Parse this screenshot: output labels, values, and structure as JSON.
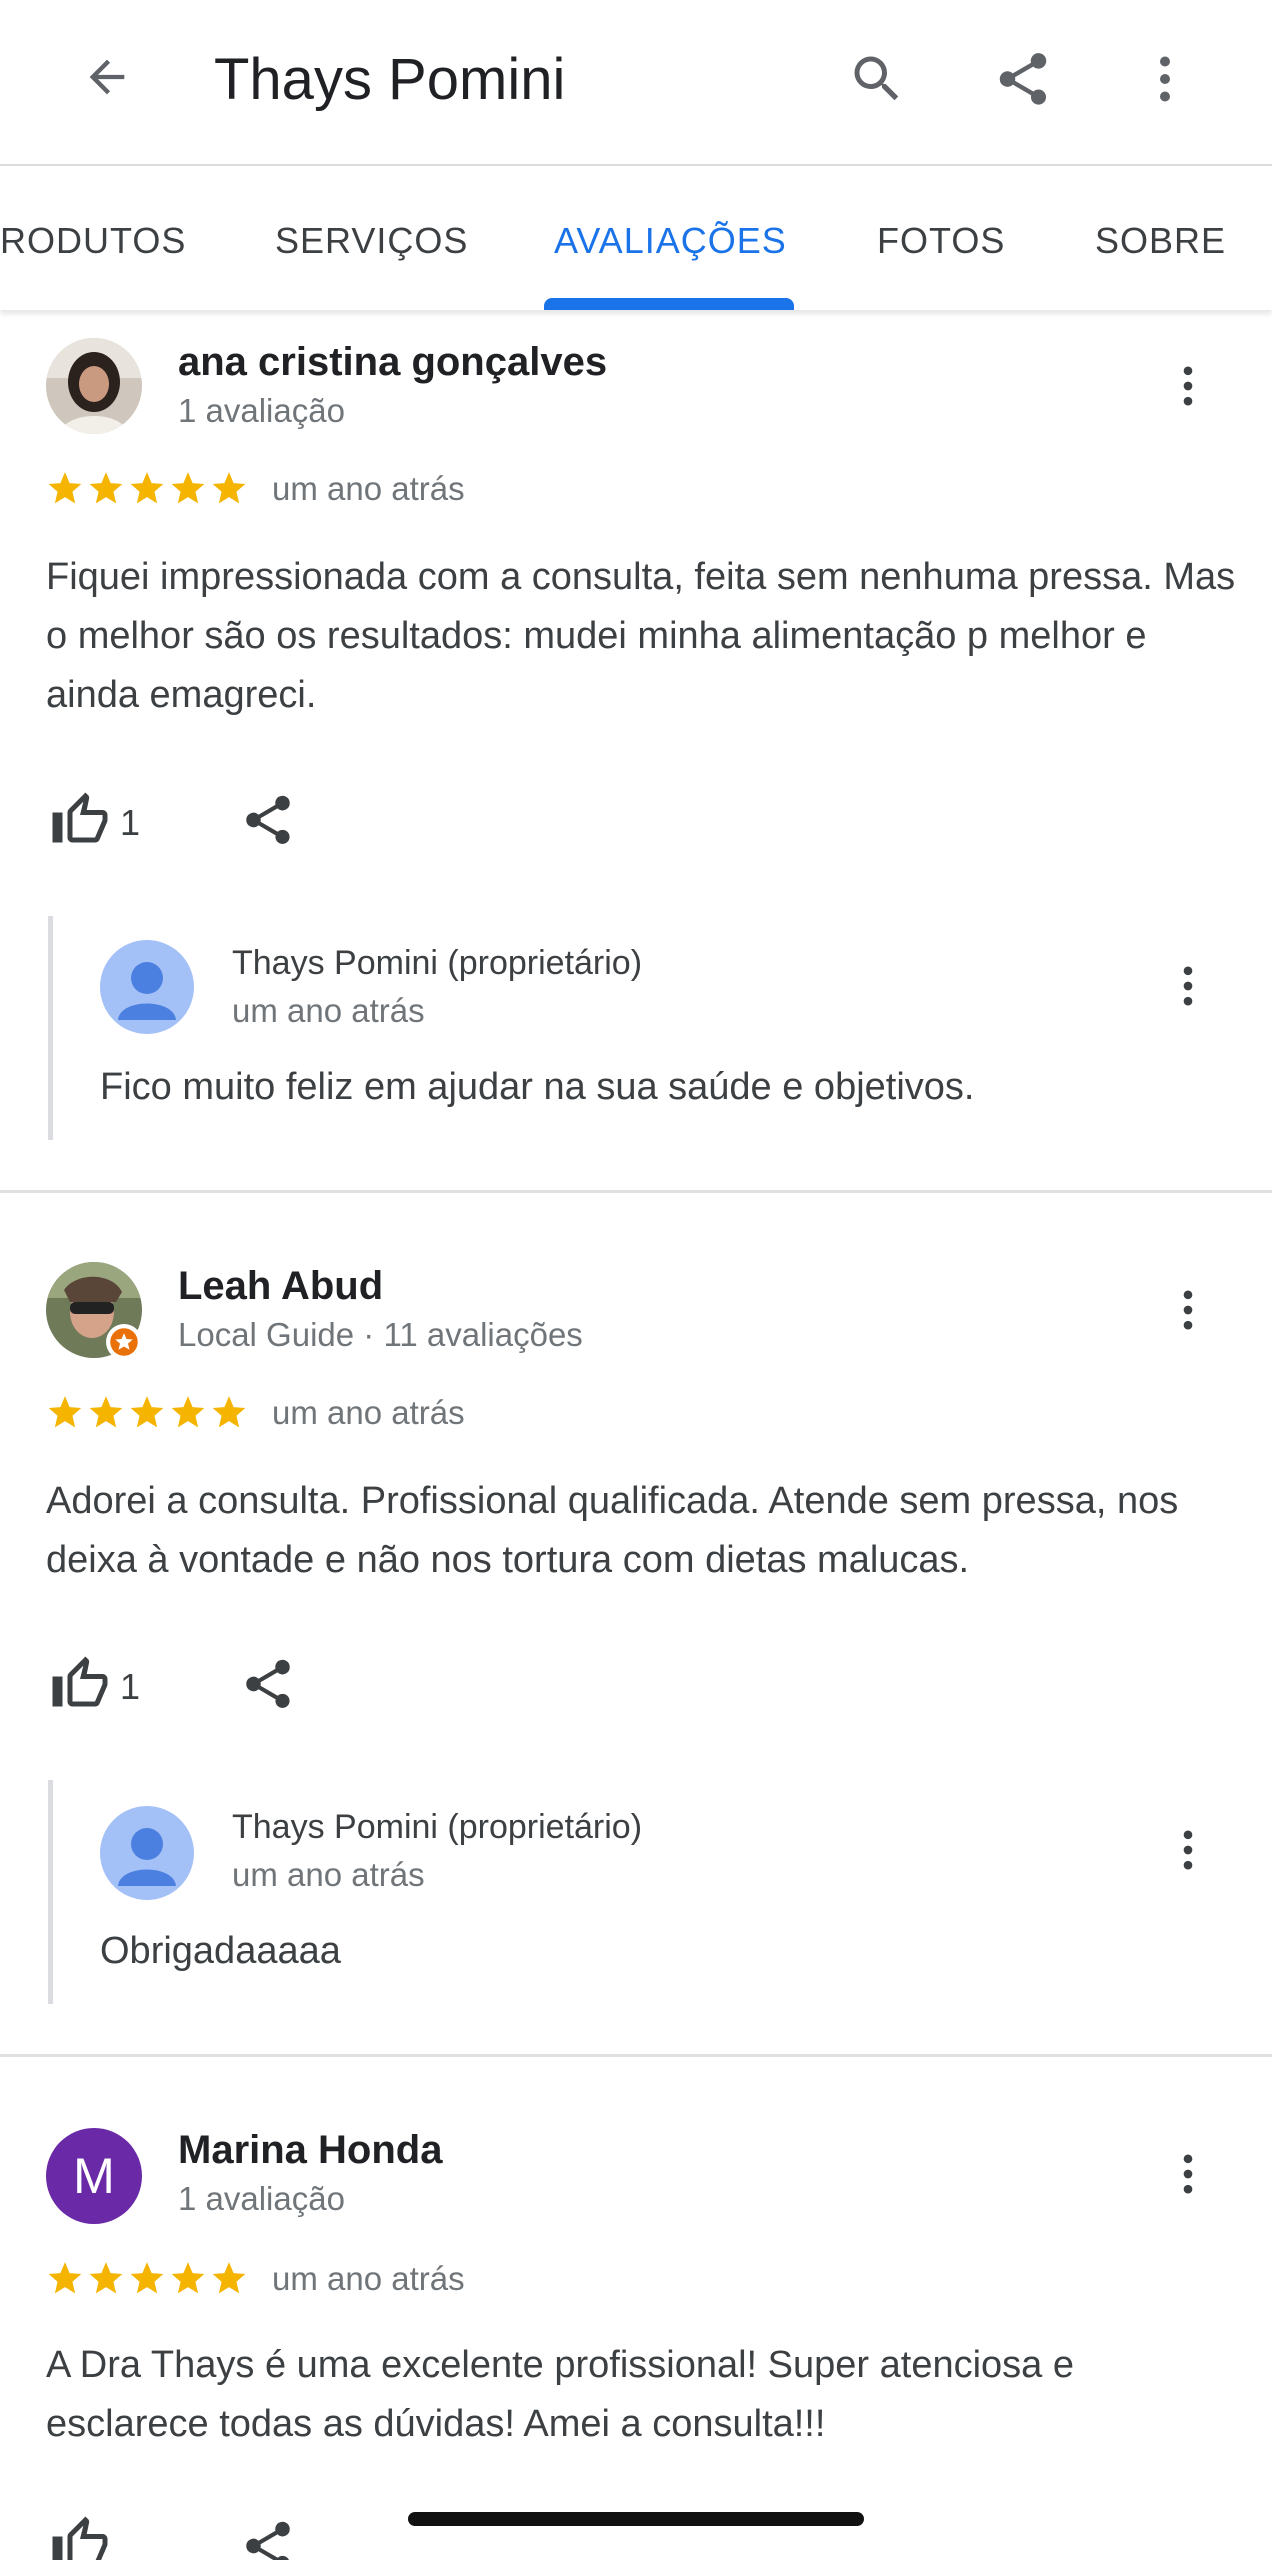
{
  "header": {
    "title": "Thays Pomini",
    "back_icon": "arrow-left-icon",
    "actions": [
      "search-icon",
      "share-icon",
      "more-vert-icon"
    ]
  },
  "tabs": [
    {
      "label": "RODUTOS",
      "active": false
    },
    {
      "label": "SERVIÇOS",
      "active": false
    },
    {
      "label": "AVALIAÇÕES",
      "active": true
    },
    {
      "label": "FOTOS",
      "active": false
    },
    {
      "label": "SOBRE",
      "active": false
    }
  ],
  "colors": {
    "accent": "#1a73e8",
    "star": "#f4b400",
    "reply_avatar_bg": "#a3c0f7",
    "marina_avatar": "#6a2aa8"
  },
  "reviews": [
    {
      "name": "ana cristina gonçalves",
      "meta": "1 avaliação",
      "rating": 5,
      "date": "um ano atrás",
      "text": "Fiquei impressionada com a consulta, feita sem nenhuma pressa. Mas o melhor são os resultados: mudei minha alimentação p melhor e ainda emagreci.",
      "likes": "1",
      "reply": {
        "name": "Thays Pomini (proprietário)",
        "date": "um ano atrás",
        "text": "Fico muito feliz em ajudar na sua saúde e objetivos."
      }
    },
    {
      "name": "Leah Abud",
      "meta": "Local Guide · 11 avaliações",
      "rating": 5,
      "date": "um ano atrás",
      "text": "Adorei a consulta. Profissional qualificada. Atende sem pressa, nos deixa à vontade e não nos tortura com dietas malucas.",
      "likes": "1",
      "reply": {
        "name": "Thays Pomini (proprietário)",
        "date": "um ano atrás",
        "text": "Obrigadaaaaa"
      }
    },
    {
      "name": "Marina Honda",
      "avatar_letter": "M",
      "meta": "1 avaliação",
      "rating": 5,
      "date": "um ano atrás",
      "text": "A Dra Thays é uma excelente profissional! Super atenciosa e esclarece todas as dúvidas! Amei a consulta!!!"
    }
  ]
}
